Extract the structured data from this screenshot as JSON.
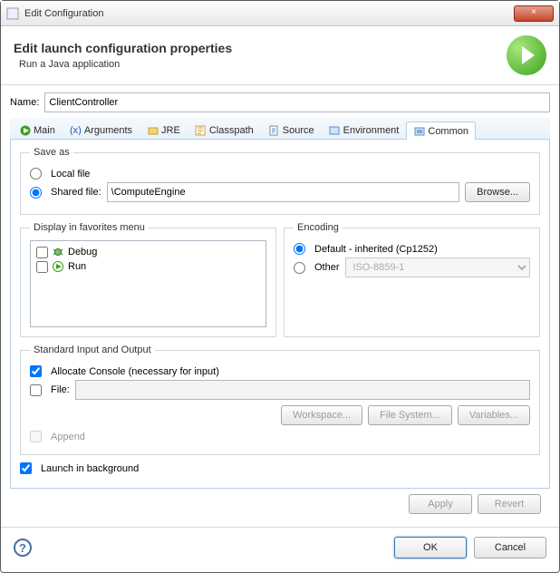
{
  "window": {
    "title": "Edit Configuration",
    "close": "×"
  },
  "banner": {
    "title": "Edit launch configuration properties",
    "subtitle": "Run a Java application"
  },
  "name": {
    "label": "Name:",
    "value": "ClientController"
  },
  "tabs": {
    "main": "Main",
    "arguments": "Arguments",
    "jre": "JRE",
    "classpath": "Classpath",
    "source": "Source",
    "environment": "Environment",
    "common": "Common"
  },
  "saveAs": {
    "legend": "Save as",
    "localFile": "Local file",
    "sharedFile": "Shared file:",
    "sharedValue": "\\ComputeEngine",
    "browse": "Browse..."
  },
  "favorites": {
    "legend": "Display in favorites menu",
    "items": [
      {
        "label": "Debug",
        "checked": false
      },
      {
        "label": "Run",
        "checked": false
      }
    ]
  },
  "encoding": {
    "legend": "Encoding",
    "defaultLabel": "Default - inherited (Cp1252)",
    "otherLabel": "Other",
    "otherValue": "ISO-8859-1"
  },
  "io": {
    "legend": "Standard Input and Output",
    "allocate": "Allocate Console (necessary for input)",
    "file": "File:",
    "workspace": "Workspace...",
    "fileSystem": "File System...",
    "variables": "Variables...",
    "append": "Append"
  },
  "launchBg": "Launch in background",
  "buttons": {
    "apply": "Apply",
    "revert": "Revert",
    "ok": "OK",
    "cancel": "Cancel"
  }
}
